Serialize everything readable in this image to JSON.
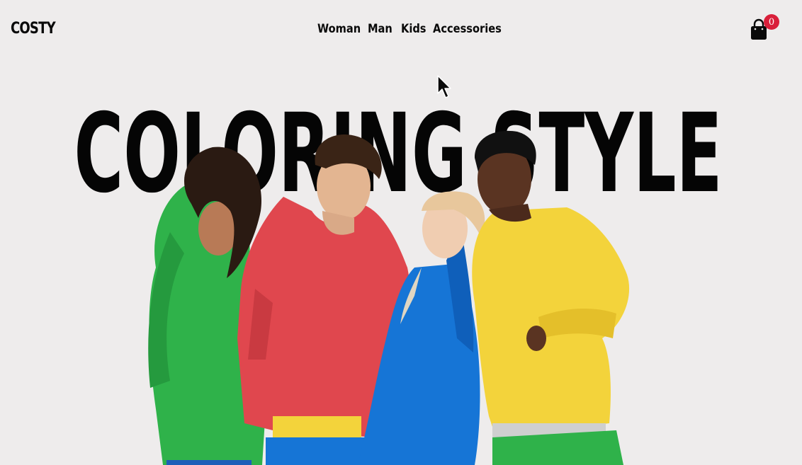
{
  "brand": {
    "logo": "COSTY"
  },
  "nav": {
    "items": [
      {
        "label": "Woman"
      },
      {
        "label": "Man"
      },
      {
        "label": "Kids"
      },
      {
        "label": "Accessories"
      }
    ]
  },
  "cart": {
    "count": "0",
    "icon": "shopping-bag-icon",
    "badge_color": "#d91f3a"
  },
  "hero": {
    "title": "COLORING STYLE",
    "image": "four-models-in-colorful-hoodies",
    "hoodie_colors": [
      "#2fb24a",
      "#e0474e",
      "#1675d6",
      "#f3d33b"
    ],
    "background": "#eeecec"
  }
}
